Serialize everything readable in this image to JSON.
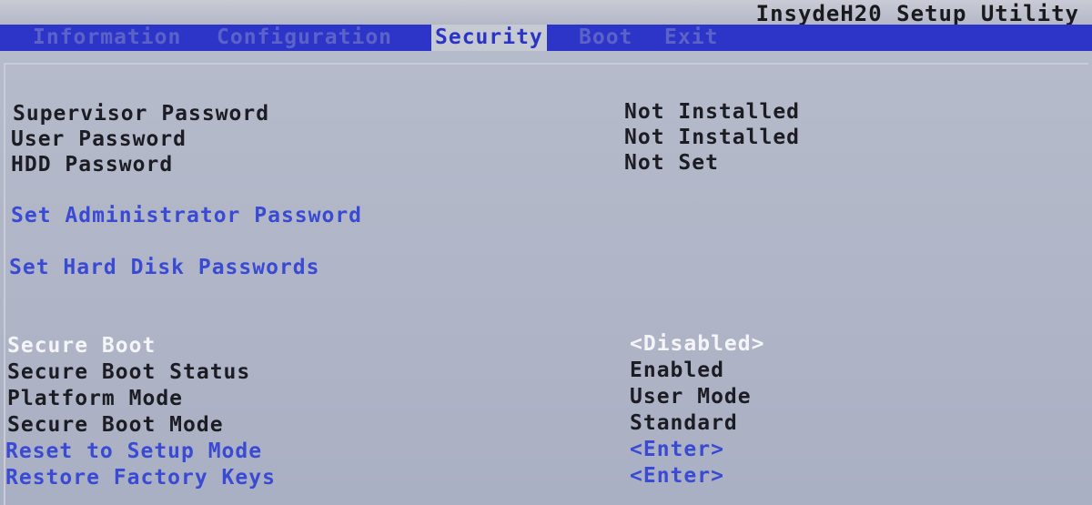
{
  "app": {
    "title": "InsydeH20 Setup Utility"
  },
  "menu": {
    "tabs": [
      {
        "label": "Information"
      },
      {
        "label": "Configuration"
      },
      {
        "label": "Security"
      },
      {
        "label": "Boot"
      },
      {
        "label": "Exit"
      }
    ],
    "active": "Security"
  },
  "security": {
    "supervisor_password": {
      "label": "Supervisor Password",
      "value": "Not Installed"
    },
    "user_password": {
      "label": "User Password",
      "value": "Not Installed"
    },
    "hdd_password": {
      "label": "HDD Password",
      "value": "Not Set"
    },
    "set_admin_password": {
      "label": "Set Administrator Password"
    },
    "set_hdd_passwords": {
      "label": "Set Hard Disk Passwords"
    },
    "secure_boot": {
      "label": "Secure Boot",
      "value": "<Disabled>"
    },
    "secure_boot_status": {
      "label": "Secure Boot Status",
      "value": "Enabled"
    },
    "platform_mode": {
      "label": "Platform Mode",
      "value": "User Mode"
    },
    "secure_boot_mode": {
      "label": "Secure Boot Mode",
      "value": "Standard"
    },
    "reset_setup_mode": {
      "label": "Reset to Setup Mode",
      "value": "<Enter>"
    },
    "restore_factory_keys": {
      "label": "Restore Factory Keys",
      "value": "<Enter>"
    }
  },
  "colors": {
    "menubar": "#2d35c9",
    "background": "#b6bbcb",
    "link_text": "#3a4ad2",
    "highlight_text": "#f4f5f8",
    "static_text": "#1c1c24"
  }
}
